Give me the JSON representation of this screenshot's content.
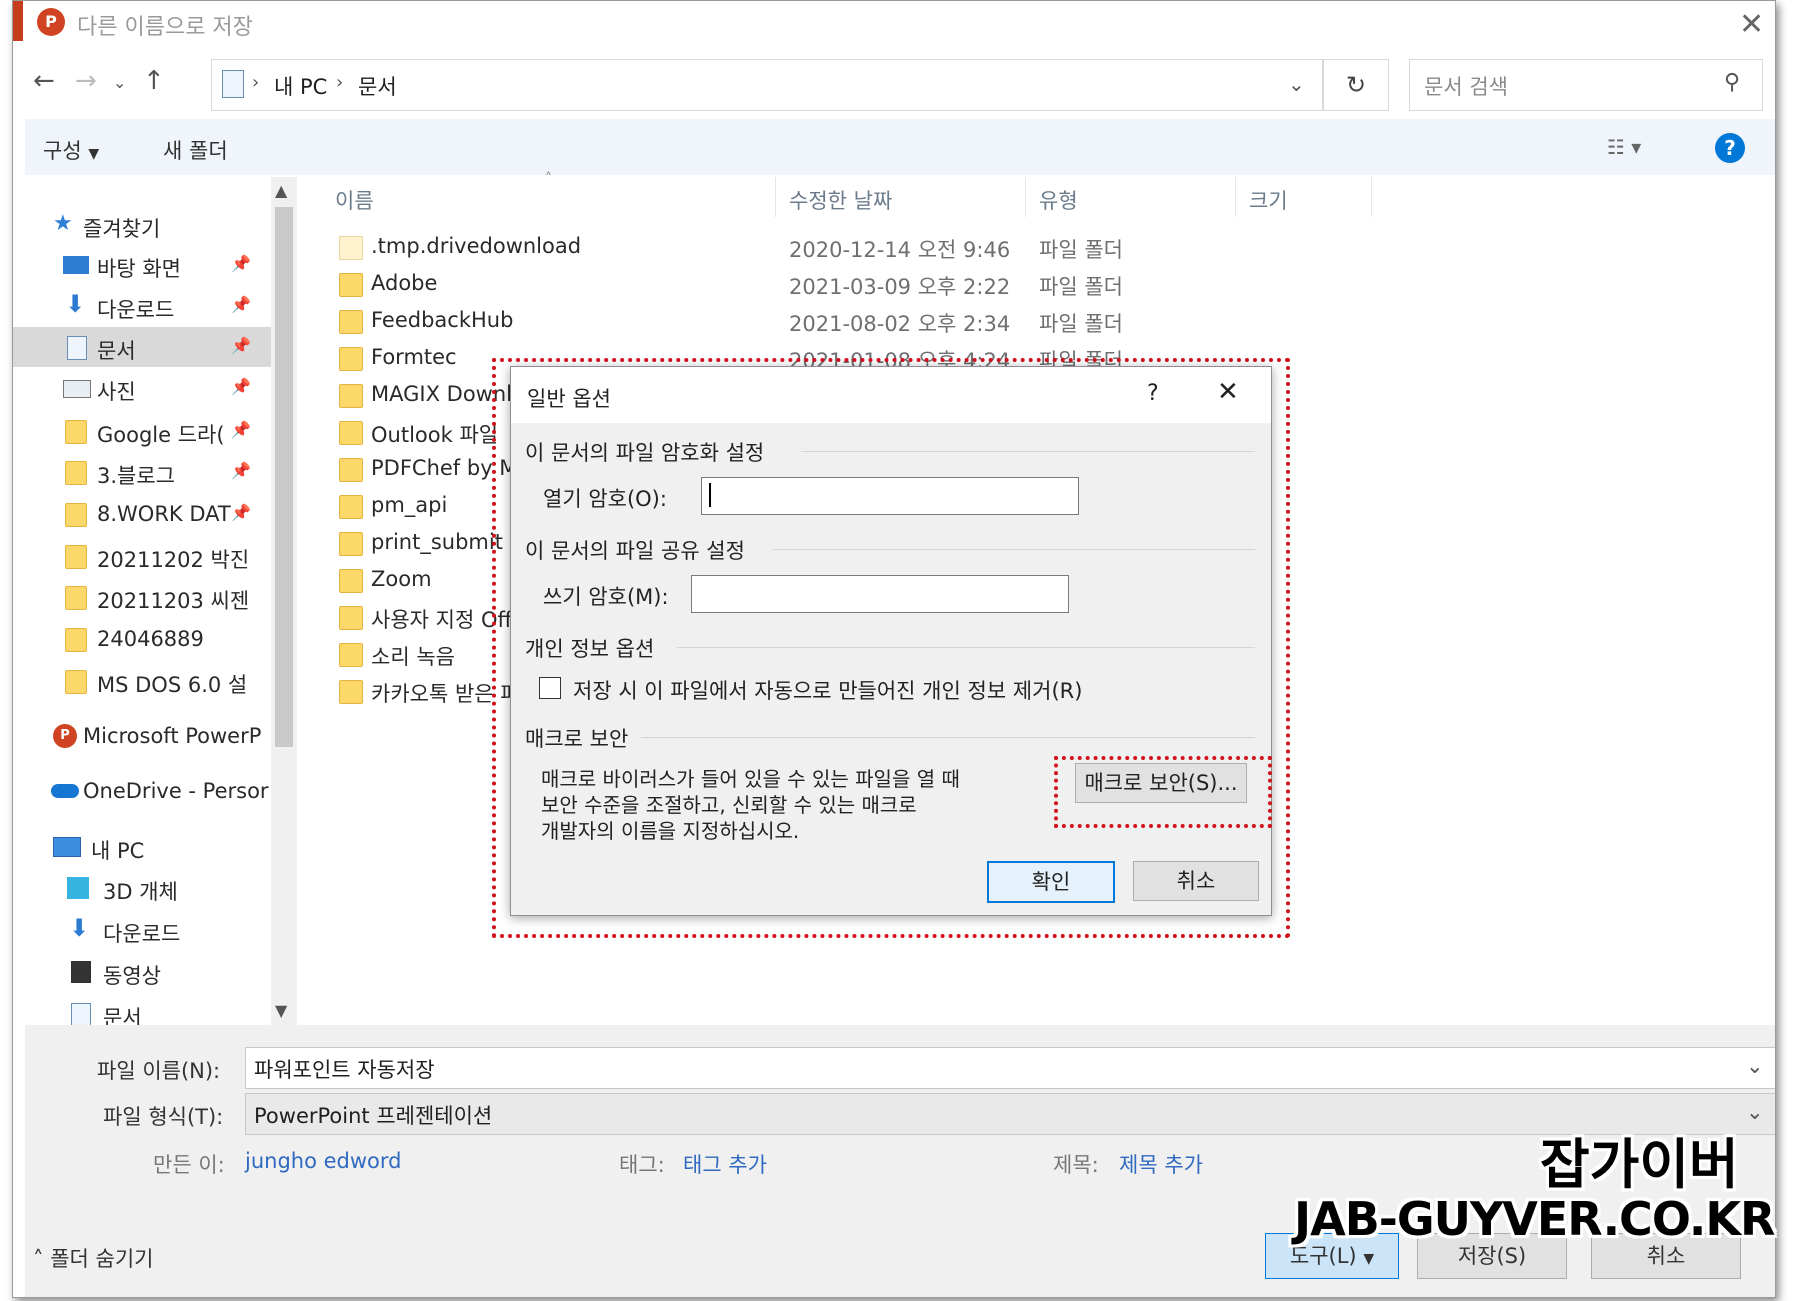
{
  "window": {
    "title": "다른 이름으로 저장"
  },
  "address": {
    "crumbs": [
      "내 PC",
      "문서"
    ]
  },
  "search": {
    "placeholder": "문서 검색"
  },
  "commands": {
    "organize": "구성",
    "new_folder": "새 폴더"
  },
  "sidebar": {
    "items": [
      {
        "label": "즐겨찾기"
      },
      {
        "label": "바탕 화면"
      },
      {
        "label": "다운로드"
      },
      {
        "label": "문서"
      },
      {
        "label": "사진"
      },
      {
        "label": "Google 드라("
      },
      {
        "label": "3.블로그"
      },
      {
        "label": "8.WORK DAT"
      },
      {
        "label": "20211202 박진"
      },
      {
        "label": "20211203 씨젠"
      },
      {
        "label": "24046889"
      },
      {
        "label": "MS DOS 6.0 설"
      },
      {
        "label": "Microsoft PowerP"
      },
      {
        "label": "OneDrive - Persor"
      },
      {
        "label": "내 PC"
      },
      {
        "label": "3D 개체"
      },
      {
        "label": "다운로드"
      },
      {
        "label": "동영상"
      },
      {
        "label": "문서"
      }
    ]
  },
  "columns": {
    "name": "이름",
    "modified": "수정한 날짜",
    "type": "유형",
    "size": "크기"
  },
  "files": [
    {
      "name": ".tmp.drivedownload",
      "date": "2020-12-14 오전 9:46",
      "type": "파일 폴더"
    },
    {
      "name": "Adobe",
      "date": "2021-03-09 오후 2:22",
      "type": "파일 폴더"
    },
    {
      "name": "FeedbackHub",
      "date": "2021-08-02 오후 2:34",
      "type": "파일 폴더"
    },
    {
      "name": "Formtec",
      "date": "2021-01-08 오후 4:24",
      "type": "파일 폴더"
    },
    {
      "name": "MAGIX Downloa"
    },
    {
      "name": "Outlook 파일"
    },
    {
      "name": "PDFChef by Mo"
    },
    {
      "name": "pm_api"
    },
    {
      "name": "print_submit"
    },
    {
      "name": "Zoom"
    },
    {
      "name": "사용자 지정 Offi"
    },
    {
      "name": "소리 녹음"
    },
    {
      "name": "카카오톡 받은 파"
    }
  ],
  "bottom": {
    "filename_label": "파일 이름(N):",
    "filename_value": "파워포인트 자동저장",
    "filetype_label": "파일 형식(T):",
    "filetype_value": "PowerPoint 프레젠테이션",
    "author_label": "만든 이:",
    "author_value": "jungho edword",
    "tags_label": "태그:",
    "tags_value": "태그 추가",
    "title_label": "제목:",
    "title_value": "제목 추가",
    "hide_folders": "폴더 숨기기",
    "tools": "도구(L)",
    "save": "저장(S)",
    "cancel": "취소"
  },
  "dialog": {
    "title": "일반 옵션",
    "help": "?",
    "sec_encrypt": "이 문서의 파일 암호화 설정",
    "open_pw_label": "열기 암호(O):",
    "sec_share": "이 문서의 파일 공유 설정",
    "write_pw_label": "쓰기 암호(M):",
    "sec_privacy": "개인 정보 옵션",
    "privacy_checkbox": "저장 시 이 파일에서 자동으로 만들어진 개인 정보 제거(R)",
    "sec_macro": "매크로 보안",
    "macro_desc_1": "매크로 바이러스가 들어 있을 수 있는 파일을 열 때",
    "macro_desc_2": "보안 수준을 조절하고, 신뢰할 수 있는 매크로",
    "macro_desc_3": "개발자의 이름을 지정하십시오.",
    "macro_button": "매크로 보안(S)...",
    "ok": "확인",
    "cancel": "취소"
  },
  "watermark": {
    "line1": "잡가이버",
    "line2": "JAB-GUYVER.CO.KR"
  },
  "colors": {
    "accent": "#0078d7",
    "highlight": "#d0121b",
    "folder": "#fcd76a"
  }
}
